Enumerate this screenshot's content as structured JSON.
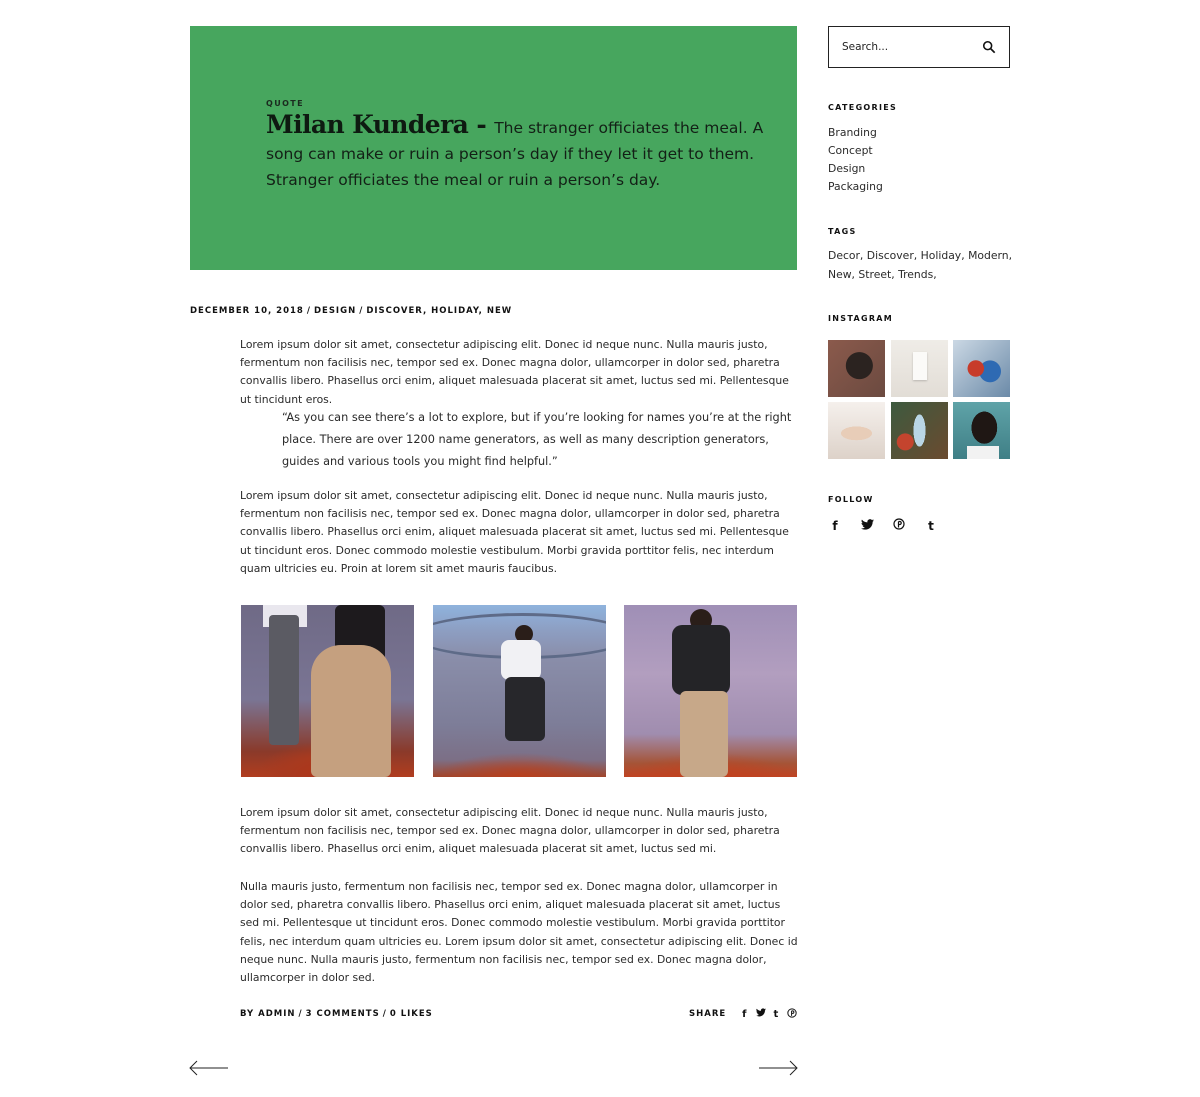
{
  "hero": {
    "label": "QUOTE",
    "author": "Milan Kundera",
    "separator": " - ",
    "text": "The stranger officiates the meal. A song can make or ruin a person’s day if they let it get to them. Stranger officiates the meal or ruin a person’s day.",
    "background_color": "#47a65e"
  },
  "meta": {
    "date": "DECEMBER 10, 2018",
    "category": "DESIGN",
    "tags": "DISCOVER, HOLIDAY, NEW",
    "sep": "/"
  },
  "content": {
    "p1": "Lorem ipsum dolor sit amet, consectetur adipiscing elit. Donec id neque nunc. Nulla mauris justo, fermentum non facilisis nec, tempor sed ex. Donec magna dolor, ullamcorper in dolor sed, pharetra convallis libero. Phasellus orci enim, aliquet malesuada placerat sit amet, luctus sed mi. Pellentesque ut tincidunt eros.",
    "blockquote": "“As you can see there’s a lot to explore, but if you’re looking for names you’re at the right place. There are over 1200 name generators, as well as many description generators, guides and various tools you might find helpful.”",
    "p2": "Lorem ipsum dolor sit amet, consectetur adipiscing elit. Donec id neque nunc. Nulla mauris justo, fermentum non facilisis nec, tempor sed ex. Donec magna dolor, ullamcorper in dolor sed, pharetra convallis libero. Phasellus orci enim, aliquet malesuada placerat sit amet, luctus sed mi. Pellentesque ut tincidunt eros. Donec commodo molestie vestibulum. Morbi gravida porttitor felis, nec interdum quam ultricies eu. Proin at lorem sit amet mauris faucibus.",
    "p3": "Lorem ipsum dolor sit amet, consectetur adipiscing elit. Donec id neque nunc. Nulla mauris justo, fermentum non facilisis nec, tempor sed ex. Donec magna dolor, ullamcorper in dolor sed, pharetra convallis libero. Phasellus orci enim, aliquet malesuada placerat sit amet, luctus sed mi.",
    "p4": "Nulla mauris justo, fermentum non facilisis nec, tempor sed ex. Donec magna dolor, ullamcorper in dolor sed, pharetra convallis libero. Phasellus orci enim, aliquet malesuada placerat sit amet, luctus sed mi. Pellentesque ut tincidunt eros. Donec commodo molestie vestibulum. Morbi gravida porttitor felis, nec interdum quam ultricies eu. Lorem ipsum dolor sit amet, consectetur adipiscing elit. Donec id neque nunc. Nulla mauris justo, fermentum non facilisis nec, tempor sed ex. Donec magna dolor, ullamcorper in dolor sed."
  },
  "post_footer": {
    "author": "BY ADMIN",
    "comments": "3 COMMENTS",
    "likes": "0 LIKES",
    "sep": "/",
    "share_label": "SHARE",
    "share_icons": [
      "facebook-icon",
      "twitter-icon",
      "tumblr-icon",
      "pinterest-icon"
    ]
  },
  "sidebar": {
    "search": {
      "placeholder": "Search...",
      "icon": "search-icon"
    },
    "categories": {
      "title": "CATEGORIES",
      "items": [
        "Branding",
        "Concept",
        "Design",
        "Packaging"
      ]
    },
    "tags": {
      "title": "TAGS",
      "text": "Decor, Discover, Holiday, Modern, New, Street, Trends,"
    },
    "instagram": {
      "title": "INSTAGRAM"
    },
    "follow": {
      "title": "FOLLOW",
      "icons": [
        "facebook-icon",
        "twitter-icon",
        "pinterest-icon",
        "tumblr-icon"
      ]
    }
  },
  "nav": {
    "prev_icon": "arrow-left-icon",
    "next_icon": "arrow-right-icon"
  }
}
